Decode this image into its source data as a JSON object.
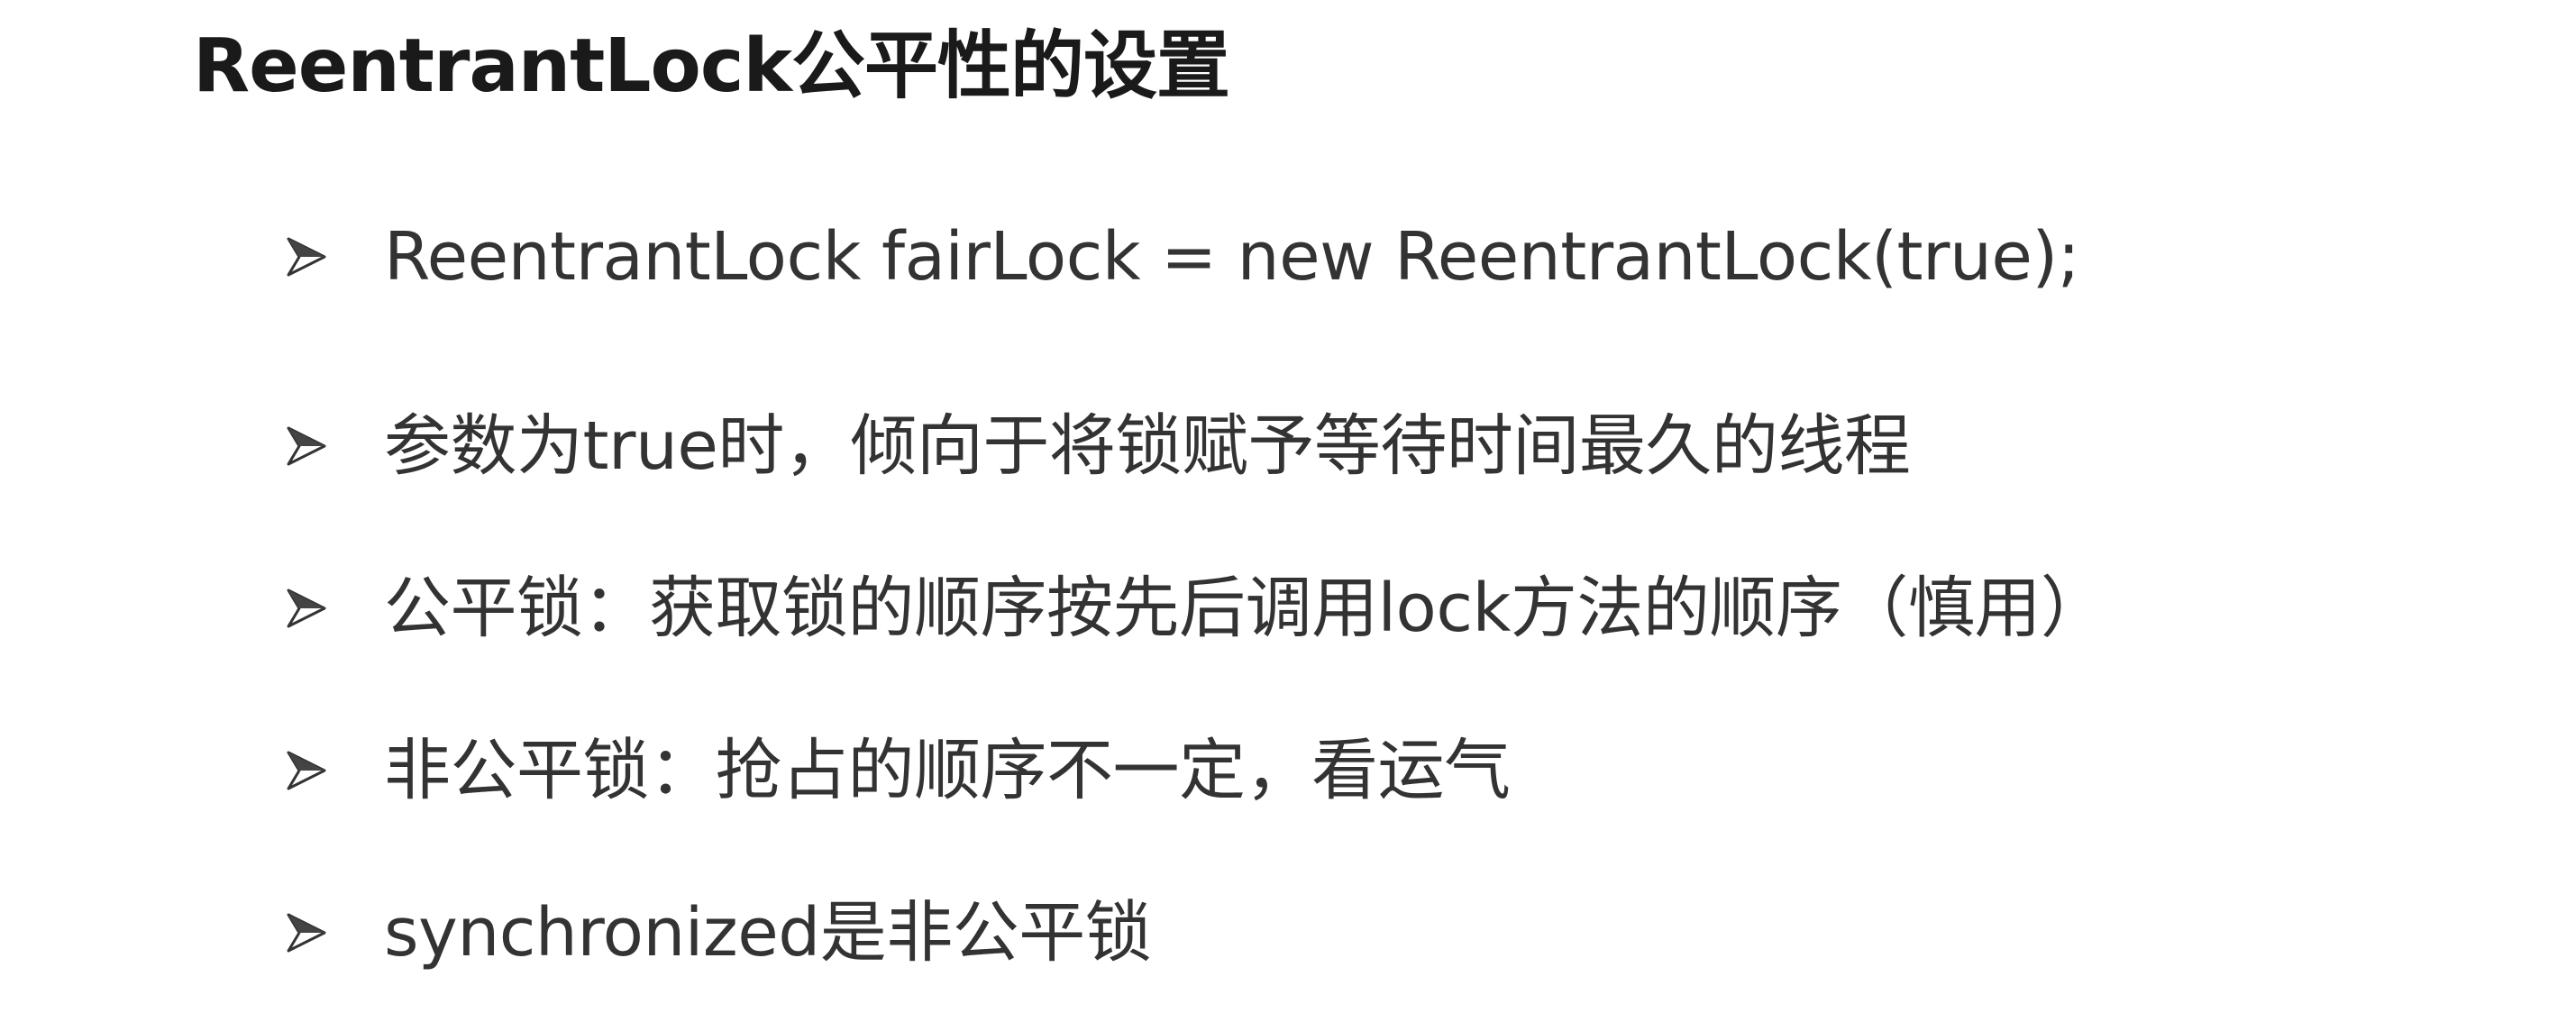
{
  "slide": {
    "title": "ReentrantLock公平性的设置",
    "bullets": [
      {
        "text": "ReentrantLock fairLock = new ReentrantLock(true);"
      },
      {
        "text": "参数为true时，倾向于将锁赋予等待时间最久的线程"
      },
      {
        "text": "公平锁：获取锁的顺序按先后调用lock方法的顺序（慎用）"
      },
      {
        "text": "非公平锁：抢占的顺序不一定，看运气"
      },
      {
        "text": "synchronized是非公平锁"
      }
    ],
    "bullet_icon": "arrow-bullet-icon",
    "colors": {
      "title": "#1a1a1a",
      "text": "#333333",
      "background": "#ffffff"
    }
  }
}
